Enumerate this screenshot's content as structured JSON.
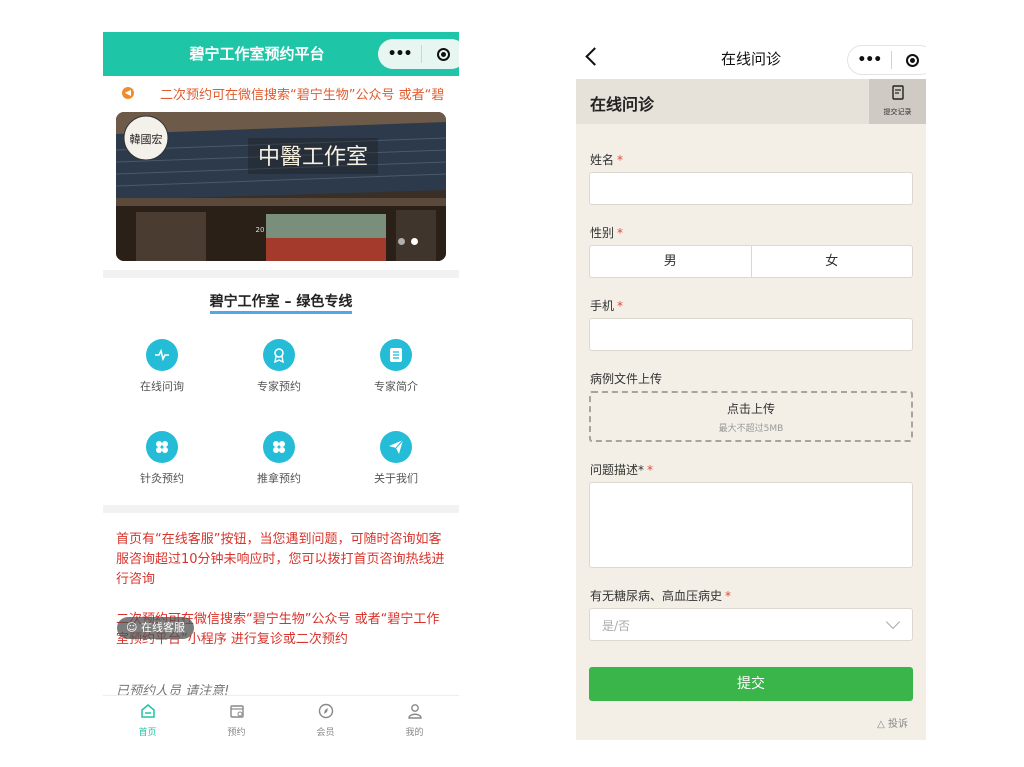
{
  "left": {
    "header": {
      "title": "碧宁工作室预约平台"
    },
    "notice": {
      "text": "二次预约可在微信搜索“碧宁生物”公众号 或者“碧"
    },
    "banner": {
      "sign_text": "中醫工作室",
      "logo_text": "韓國宏",
      "door_number": "20"
    },
    "section_title": "碧宁工作室 – 绿色专线",
    "grid": [
      {
        "label": "在线问询",
        "icon": "pulse-icon"
      },
      {
        "label": "专家预约",
        "icon": "badge-icon"
      },
      {
        "label": "专家简介",
        "icon": "document-icon"
      },
      {
        "label": "针灸预约",
        "icon": "clover-icon"
      },
      {
        "label": "推拿预约",
        "icon": "clover-icon"
      },
      {
        "label": "关于我们",
        "icon": "paper-plane-icon"
      }
    ],
    "messages": {
      "p1": "首页有“在线客服”按钮，当您遇到问题，可随时咨询如客服咨询超过10分钟未响应时，您可以拨打首页咨询热线进行咨询",
      "p2": "二次预约可在微信搜索“碧宁生物”公众号 或者“碧宁工作室预约平台”小程序 进行复诊或二次预约",
      "p3": "已预约人员 请注意!"
    },
    "kefu_button": "在线客服",
    "tabbar": [
      {
        "label": "首页",
        "icon": "home-icon",
        "active": true
      },
      {
        "label": "预约",
        "icon": "calendar-icon",
        "active": false
      },
      {
        "label": "会员",
        "icon": "compass-icon",
        "active": false
      },
      {
        "label": "我的",
        "icon": "user-icon",
        "active": false
      }
    ],
    "colors": {
      "header": "#1fc5a7",
      "accent_text": "#d8332b",
      "icon_bg": "#24bcd6"
    }
  },
  "right": {
    "nav": {
      "title": "在线问诊"
    },
    "header": {
      "title": "在线问诊",
      "record_button": "提交记录"
    },
    "form": {
      "name_label": "姓名",
      "gender_label": "性别",
      "gender_options": [
        "男",
        "女"
      ],
      "phone_label": "手机",
      "upload_label": "病例文件上传",
      "upload_button": "点击上传",
      "upload_hint": "最大不超过5MB",
      "desc_label": "问题描述*",
      "history_label": "有无糖尿病、高血压病史",
      "history_placeholder": "是/否",
      "required_mark": "*"
    },
    "submit_label": "提交",
    "complain_label": "投诉",
    "colors": {
      "submit": "#3ab54a",
      "background": "#f3efe6",
      "required": "#e04a3b"
    }
  }
}
